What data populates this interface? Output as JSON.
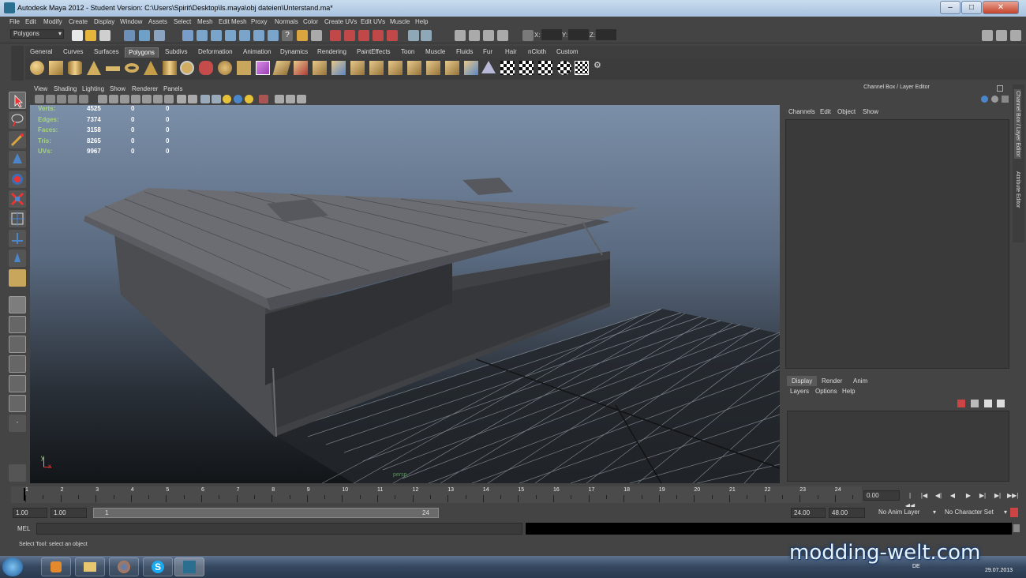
{
  "window": {
    "title": "Autodesk Maya 2012 - Student Version: C:\\Users\\Spirit\\Desktop\\ls.maya\\obj dateien\\Unterstand.ma*",
    "minimize": "–",
    "maximize": "□",
    "close": "✕"
  },
  "menubar": [
    "File",
    "Edit",
    "Modify",
    "Create",
    "Display",
    "Window",
    "Assets",
    "Select",
    "Mesh",
    "Edit Mesh",
    "Proxy",
    "Normals",
    "Color",
    "Create UVs",
    "Edit UVs",
    "Muscle",
    "Help"
  ],
  "status": {
    "menuset": "Polygons",
    "x_label": "X:",
    "y_label": "Y:",
    "z_label": "Z:"
  },
  "shelf_tabs": [
    "General",
    "Curves",
    "Surfaces",
    "Polygons",
    "Subdivs",
    "Deformation",
    "Animation",
    "Dynamics",
    "Rendering",
    "PaintEffects",
    "Toon",
    "Muscle",
    "Fluids",
    "Fur",
    "Hair",
    "nCloth",
    "Custom"
  ],
  "shelf_active": "Polygons",
  "viewport_menu": [
    "View",
    "Shading",
    "Lighting",
    "Show",
    "Renderer",
    "Panels"
  ],
  "hud": [
    {
      "label": "Verts:",
      "v1": "4525",
      "v2": "0",
      "v3": "0"
    },
    {
      "label": "Edges:",
      "v1": "7374",
      "v2": "0",
      "v3": "0"
    },
    {
      "label": "Faces:",
      "v1": "3158",
      "v2": "0",
      "v3": "0"
    },
    {
      "label": "Tris:",
      "v1": "8265",
      "v2": "0",
      "v3": "0"
    },
    {
      "label": "UVs:",
      "v1": "9967",
      "v2": "0",
      "v3": "0"
    }
  ],
  "axis": {
    "x": "x",
    "y": "y"
  },
  "camera_label": "persp",
  "channelbox": {
    "title": "Channel Box / Layer Editor",
    "menu": [
      "Channels",
      "Edit",
      "Object",
      "Show"
    ]
  },
  "side_tabs": [
    "Channel Box / Layer Editor",
    "Attribute Editor"
  ],
  "layer": {
    "tabs": [
      "Display",
      "Render",
      "Anim"
    ],
    "active": "Display",
    "menu": [
      "Layers",
      "Options",
      "Help"
    ]
  },
  "timeline": {
    "ticks": [
      "1",
      "2",
      "3",
      "4",
      "5",
      "6",
      "7",
      "8",
      "9",
      "10",
      "11",
      "12",
      "13",
      "14",
      "15",
      "16",
      "17",
      "18",
      "19",
      "20",
      "21",
      "22",
      "23",
      "24"
    ],
    "current": "0.00"
  },
  "range": {
    "start": "1.00",
    "start2": "1.00",
    "slider_start": "1",
    "slider_end": "24",
    "end": "24.00",
    "end2": "48.00",
    "anim_layer": "No Anim Layer",
    "char_set": "No Character Set"
  },
  "cmd": {
    "label": "MEL"
  },
  "helpline": "Select Tool: select an object",
  "watermark": "modding-welt.com",
  "taskbar": {
    "lang": "DE",
    "date": "29.07.2013"
  },
  "colors": {
    "hud_label": "#a7d37f",
    "accent": "#5a5a5a"
  }
}
